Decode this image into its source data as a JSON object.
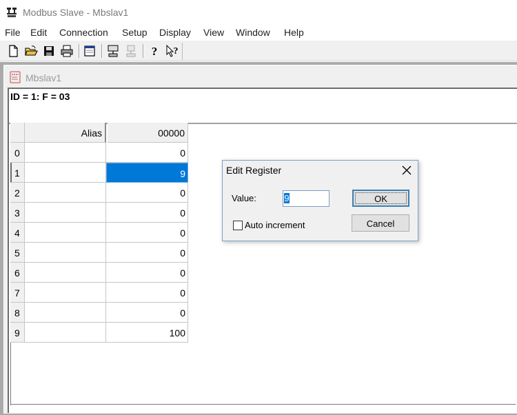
{
  "window": {
    "title": "Modbus Slave - Mbslav1",
    "icon": "modbus-app-icon"
  },
  "menu": [
    "File",
    "Edit",
    "Connection",
    "Setup",
    "Display",
    "View",
    "Window",
    "Help"
  ],
  "toolbar": {
    "buttons": [
      "new-document-icon",
      "open-folder-icon",
      "save-icon",
      "print-icon",
      "window-icon",
      "connect-icon",
      "disconnect-icon",
      "help-icon",
      "context-help-icon"
    ]
  },
  "child_window": {
    "title": "Mbslav1",
    "header": "ID = 1: F = 03"
  },
  "grid": {
    "columns": [
      "Alias",
      "00000"
    ],
    "rows": [
      {
        "num": "0",
        "alias": "",
        "value": "0"
      },
      {
        "num": "1",
        "alias": "",
        "value": "9"
      },
      {
        "num": "2",
        "alias": "",
        "value": "0"
      },
      {
        "num": "3",
        "alias": "",
        "value": "0"
      },
      {
        "num": "4",
        "alias": "",
        "value": "0"
      },
      {
        "num": "5",
        "alias": "",
        "value": "0"
      },
      {
        "num": "6",
        "alias": "",
        "value": "0"
      },
      {
        "num": "7",
        "alias": "",
        "value": "0"
      },
      {
        "num": "8",
        "alias": "",
        "value": "0"
      },
      {
        "num": "9",
        "alias": "",
        "value": "100"
      }
    ],
    "selected_row": 1,
    "selection_color": "#0078d7"
  },
  "dialog": {
    "title": "Edit Register",
    "value_label": "Value:",
    "value": "9",
    "ok_label": "OK",
    "cancel_label": "Cancel",
    "checkbox_label": "Auto increment",
    "checkbox_checked": false
  }
}
